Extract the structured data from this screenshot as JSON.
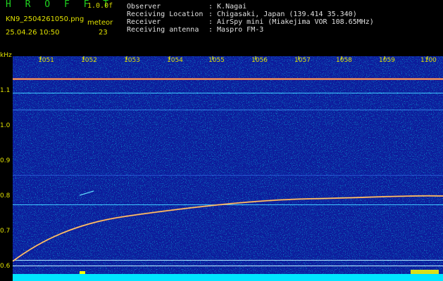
{
  "header": {
    "app_title": "H R O F F T",
    "version": "1.0.0f",
    "file_name": "KN9_2504261050.png",
    "meteor_label": "meteor",
    "timestamp": "25.04.26 10:50",
    "meteor_count": "23"
  },
  "info": [
    {
      "key": "Observer",
      "value": ": K.Nagai"
    },
    {
      "key": "Receiving Location",
      "value": ": Chigasaki, Japan (139.414 35.340)"
    },
    {
      "key": "Receiver",
      "value": ": AirSpy mini (Miakejima VOR 108.65MHz)"
    },
    {
      "key": "Receiving antenna",
      "value": ": Maspro FM-3"
    }
  ],
  "spectrogram": {
    "y_unit": "kHz",
    "y_ticks": [
      "1.1",
      "1.0",
      "0.9",
      "0.8",
      "0.7",
      "0.6"
    ],
    "x_ticks": [
      "1051",
      "1052",
      "1053",
      "1054",
      "1055",
      "1056",
      "1057",
      "1058",
      "1059",
      "1100"
    ],
    "background_color": "#0a1a9a",
    "cyan_color": "#00e5ff"
  }
}
